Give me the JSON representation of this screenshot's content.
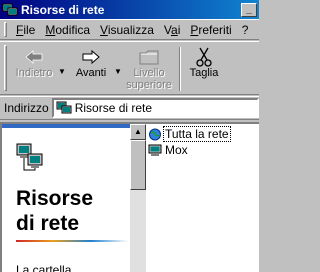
{
  "window": {
    "title": "Risorse di rete",
    "icon": "network-neighborhood-icon",
    "buttons": [
      "minimize-icon"
    ]
  },
  "menubar": {
    "items": [
      {
        "label": "File",
        "accel": "F"
      },
      {
        "label": "Modifica",
        "accel": "M"
      },
      {
        "label": "Visualizza",
        "accel": "V"
      },
      {
        "label": "Vai",
        "accel": "a"
      },
      {
        "label": "Preferiti",
        "accel": "P"
      },
      {
        "label": "?",
        "accel": ""
      }
    ]
  },
  "toolbar": {
    "back_label": "Indietro",
    "forward_label": "Avanti",
    "up_label_line1": "Livello",
    "up_label_line2": "superiore",
    "cut_label": "Taglia",
    "icons": {
      "back": "back-arrow-icon",
      "forward": "forward-arrow-icon",
      "up": "up-folder-icon",
      "cut": "scissors-icon"
    }
  },
  "addressbar": {
    "label": "Indirizzo",
    "value": "Risorse di rete"
  },
  "leftpane": {
    "heading_line1": "Risorse",
    "heading_line2": "di rete",
    "description": "La cartella"
  },
  "files": [
    {
      "name": "Tutta la rete",
      "icon": "entire-network-globe-icon",
      "focused": true
    },
    {
      "name": "Mox",
      "icon": "computer-icon",
      "focused": false
    }
  ],
  "colors": {
    "title_active": "#000080",
    "title_gradient_end": "#1084d0",
    "face": "#c0c0c0",
    "accent_rule": "#316ac5"
  }
}
